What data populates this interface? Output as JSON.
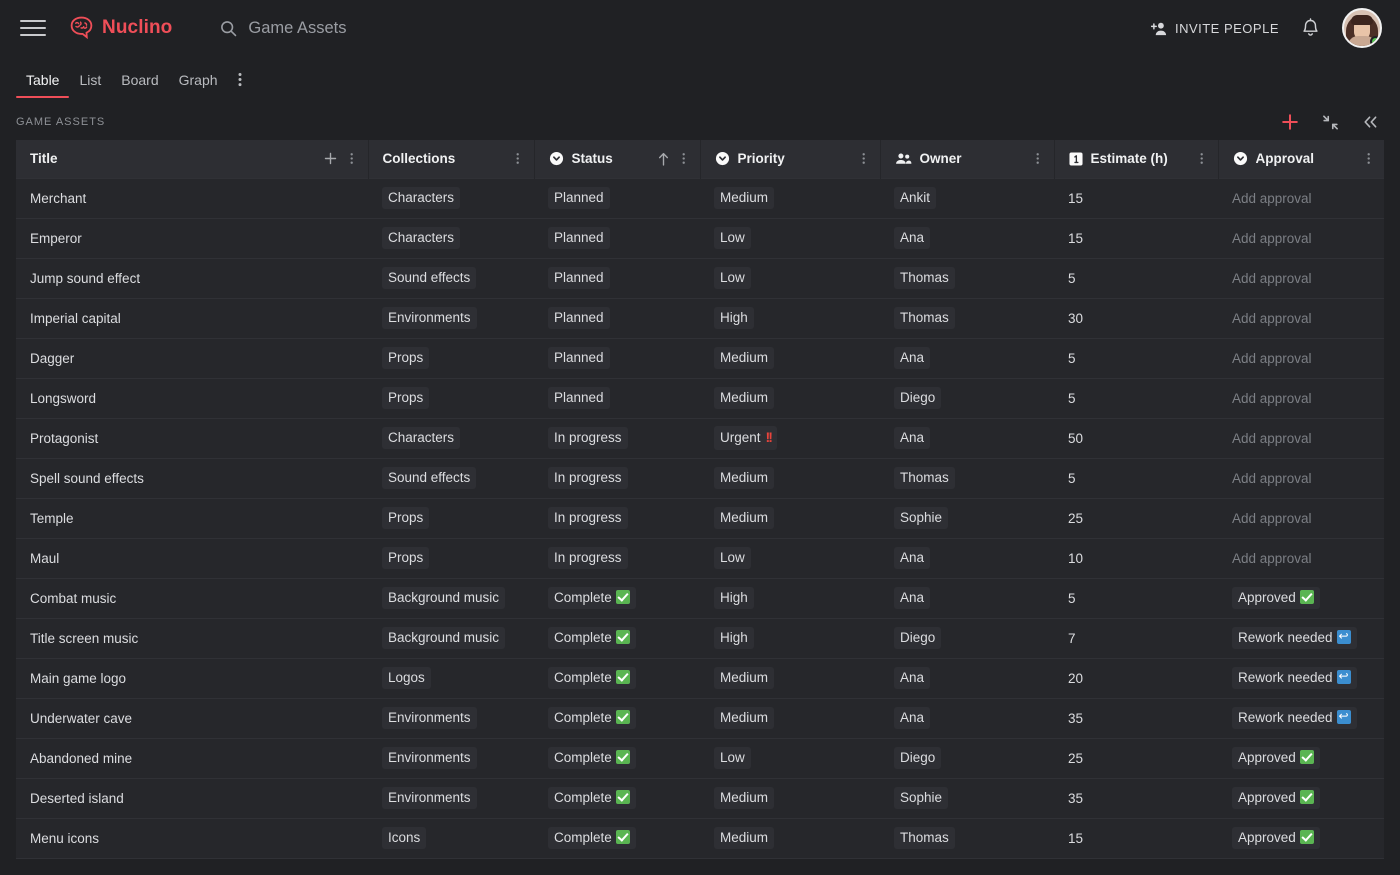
{
  "app": {
    "brand_name": "Nuclino",
    "brand_color": "#ef4e58"
  },
  "search": {
    "value": "Game Assets"
  },
  "topbar": {
    "invite_label": "INVITE PEOPLE"
  },
  "tabs": [
    {
      "label": "Table",
      "active": true
    },
    {
      "label": "List",
      "active": false
    },
    {
      "label": "Board",
      "active": false
    },
    {
      "label": "Graph",
      "active": false
    }
  ],
  "toolbar": {
    "breadcrumb": "GAME ASSETS"
  },
  "columns": [
    {
      "label": "Title",
      "icon": "none",
      "sorted": false,
      "has_add": true
    },
    {
      "label": "Collections",
      "icon": "none",
      "sorted": false,
      "has_add": false
    },
    {
      "label": "Status",
      "icon": "circle-chevron-down-icon",
      "sorted": true,
      "has_add": false
    },
    {
      "label": "Priority",
      "icon": "circle-chevron-down-icon",
      "sorted": false,
      "has_add": false
    },
    {
      "label": "Owner",
      "icon": "people-icon",
      "sorted": false,
      "has_add": false
    },
    {
      "label": "Estimate (h)",
      "icon": "number-one-icon",
      "sorted": false,
      "has_add": false
    },
    {
      "label": "Approval",
      "icon": "circle-chevron-down-icon",
      "sorted": false,
      "has_add": false
    }
  ],
  "approval_placeholder": "Add approval",
  "rows": [
    {
      "title": "Merchant",
      "collection": "Characters",
      "status": "Planned",
      "status_mark": "none",
      "priority": "Medium",
      "priority_mark": "none",
      "owner": "Ankit",
      "estimate": "15",
      "approval": "Add approval",
      "approval_mark": "none"
    },
    {
      "title": "Emperor",
      "collection": "Characters",
      "status": "Planned",
      "status_mark": "none",
      "priority": "Low",
      "priority_mark": "none",
      "owner": "Ana",
      "estimate": "15",
      "approval": "Add approval",
      "approval_mark": "none"
    },
    {
      "title": "Jump sound effect",
      "collection": "Sound effects",
      "status": "Planned",
      "status_mark": "none",
      "priority": "Low",
      "priority_mark": "none",
      "owner": "Thomas",
      "estimate": "5",
      "approval": "Add approval",
      "approval_mark": "none"
    },
    {
      "title": "Imperial capital",
      "collection": "Environments",
      "status": "Planned",
      "status_mark": "none",
      "priority": "High",
      "priority_mark": "none",
      "owner": "Thomas",
      "estimate": "30",
      "approval": "Add approval",
      "approval_mark": "none"
    },
    {
      "title": "Dagger",
      "collection": "Props",
      "status": "Planned",
      "status_mark": "none",
      "priority": "Medium",
      "priority_mark": "none",
      "owner": "Ana",
      "estimate": "5",
      "approval": "Add approval",
      "approval_mark": "none"
    },
    {
      "title": "Longsword",
      "collection": "Props",
      "status": "Planned",
      "status_mark": "none",
      "priority": "Medium",
      "priority_mark": "none",
      "owner": "Diego",
      "estimate": "5",
      "approval": "Add approval",
      "approval_mark": "none"
    },
    {
      "title": "Protagonist",
      "collection": "Characters",
      "status": "In progress",
      "status_mark": "none",
      "priority": "Urgent",
      "priority_mark": "urgent",
      "owner": "Ana",
      "estimate": "50",
      "approval": "Add approval",
      "approval_mark": "none"
    },
    {
      "title": "Spell sound effects",
      "collection": "Sound effects",
      "status": "In progress",
      "status_mark": "none",
      "priority": "Medium",
      "priority_mark": "none",
      "owner": "Thomas",
      "estimate": "5",
      "approval": "Add approval",
      "approval_mark": "none"
    },
    {
      "title": "Temple",
      "collection": "Props",
      "status": "In progress",
      "status_mark": "none",
      "priority": "Medium",
      "priority_mark": "none",
      "owner": "Sophie",
      "estimate": "25",
      "approval": "Add approval",
      "approval_mark": "none"
    },
    {
      "title": "Maul",
      "collection": "Props",
      "status": "In progress",
      "status_mark": "none",
      "priority": "Low",
      "priority_mark": "none",
      "owner": "Ana",
      "estimate": "10",
      "approval": "Add approval",
      "approval_mark": "none"
    },
    {
      "title": "Combat music",
      "collection": "Background music",
      "status": "Complete",
      "status_mark": "check",
      "priority": "High",
      "priority_mark": "none",
      "owner": "Ana",
      "estimate": "5",
      "approval": "Approved",
      "approval_mark": "check"
    },
    {
      "title": "Title screen music",
      "collection": "Background music",
      "status": "Complete",
      "status_mark": "check",
      "priority": "High",
      "priority_mark": "none",
      "owner": "Diego",
      "estimate": "7",
      "approval": "Rework needed",
      "approval_mark": "rework"
    },
    {
      "title": "Main game logo",
      "collection": "Logos",
      "status": "Complete",
      "status_mark": "check",
      "priority": "Medium",
      "priority_mark": "none",
      "owner": "Ana",
      "estimate": "20",
      "approval": "Rework needed",
      "approval_mark": "rework"
    },
    {
      "title": "Underwater cave",
      "collection": "Environments",
      "status": "Complete",
      "status_mark": "check",
      "priority": "Medium",
      "priority_mark": "none",
      "owner": "Ana",
      "estimate": "35",
      "approval": "Rework needed",
      "approval_mark": "rework"
    },
    {
      "title": "Abandoned mine",
      "collection": "Environments",
      "status": "Complete",
      "status_mark": "check",
      "priority": "Low",
      "priority_mark": "none",
      "owner": "Diego",
      "estimate": "25",
      "approval": "Approved",
      "approval_mark": "check"
    },
    {
      "title": "Deserted island",
      "collection": "Environments",
      "status": "Complete",
      "status_mark": "check",
      "priority": "Medium",
      "priority_mark": "none",
      "owner": "Sophie",
      "estimate": "35",
      "approval": "Approved",
      "approval_mark": "check"
    },
    {
      "title": "Menu icons",
      "collection": "Icons",
      "status": "Complete",
      "status_mark": "check",
      "priority": "Medium",
      "priority_mark": "none",
      "owner": "Thomas",
      "estimate": "15",
      "approval": "Approved",
      "approval_mark": "check"
    }
  ]
}
